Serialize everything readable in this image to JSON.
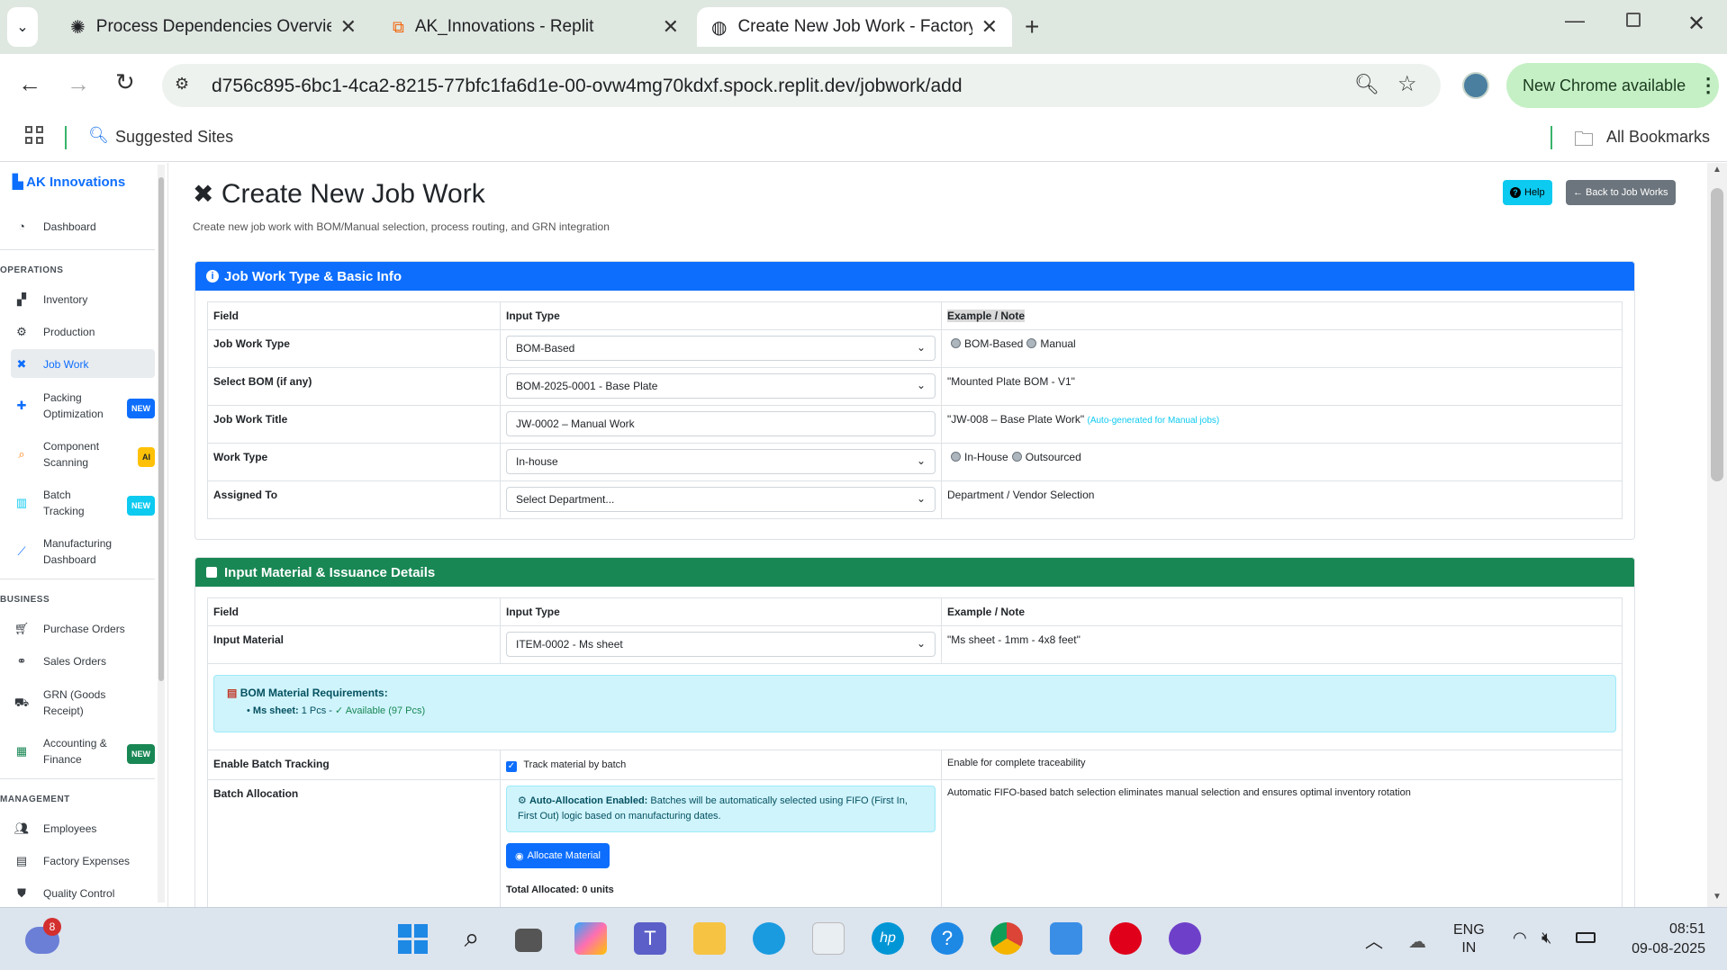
{
  "browser": {
    "tabs": [
      {
        "title": "Process Dependencies Overview"
      },
      {
        "title": "AK_Innovations - Replit"
      },
      {
        "title": "Create New Job Work - Factory"
      }
    ],
    "url": "d756c895-6bc1-4ca2-8215-77bfc1fa6d1e-00-ovw4mg70kdxf.spock.replit.dev/jobwork/add",
    "chrome_update": "New Chrome available",
    "bookmarks_left": "Suggested Sites",
    "bookmarks_right": "All Bookmarks"
  },
  "sidebar": {
    "brand": "AK Innovations",
    "dashboard": "Dashboard",
    "sec_operations": "OPERATIONS",
    "inventory": "Inventory",
    "production": "Production",
    "jobwork": "Job Work",
    "packing_1": "Packing",
    "packing_2": "Optimization",
    "component_1": "Component",
    "component_2": "Scanning",
    "batch_1": "Batch",
    "batch_2": "Tracking",
    "mfg_1": "Manufacturing",
    "mfg_2": "Dashboard",
    "sec_business": "BUSINESS",
    "po": "Purchase Orders",
    "so": "Sales Orders",
    "grn_1": "GRN (Goods",
    "grn_2": "Receipt)",
    "acct_1": "Accounting &",
    "acct_2": "Finance",
    "sec_management": "MANAGEMENT",
    "employees": "Employees",
    "expenses": "Factory Expenses",
    "quality": "Quality Control",
    "badge_new": "NEW",
    "badge_ai": "AI"
  },
  "page": {
    "title": "Create New Job Work",
    "subtitle": "Create new job work with BOM/Manual selection, process routing, and GRN integration",
    "help_btn": "Help",
    "back_btn": "← Back to Job Works"
  },
  "card1": {
    "header": "Job Work Type & Basic Info",
    "col_field": "Field",
    "col_input": "Input Type",
    "col_note": "Example / Note",
    "r1_field": "Job Work Type",
    "r1_value": "BOM-Based",
    "r1_opt1": "BOM-Based",
    "r1_opt2": "Manual",
    "r2_field": "Select BOM (if any)",
    "r2_value": "BOM-2025-0001 - Base Plate",
    "r2_note": "\"Mounted Plate BOM - V1\"",
    "r3_field": "Job Work Title",
    "r3_value": "JW-0002 – Manual Work",
    "r3_note": "\"JW-008 – Base Plate Work\"",
    "r3_note_hint": "(Auto-generated for Manual jobs)",
    "r4_field": "Work Type",
    "r4_value": "In-house",
    "r4_opt1": "In-House",
    "r4_opt2": "Outsourced",
    "r5_field": "Assigned To",
    "r5_value": "Select Department...",
    "r5_note": "Department / Vendor Selection"
  },
  "card2": {
    "header": "Input Material & Issuance Details",
    "col_field": "Field",
    "col_input": "Input Type",
    "col_note": "Example / Note",
    "r1_field": "Input Material",
    "r1_value": "ITEM-0002 - Ms sheet",
    "r1_note": "\"Ms sheet - 1mm - 4x8 feet\"",
    "bom_title": "BOM Material Requirements:",
    "bom_item": "Ms sheet:",
    "bom_qty": "1 Pcs -",
    "bom_avail": "✓ Available (97 Pcs)",
    "r2_field": "Enable Batch Tracking",
    "r2_check": "Track material by batch",
    "r2_note": "Enable for complete traceability",
    "r3_field": "Batch Allocation",
    "auto_title": "Auto-Allocation Enabled:",
    "auto_text": "Batches will be automatically selected using FIFO (First In, First Out) logic based on manufacturing dates.",
    "allocate_btn": "Allocate Material",
    "total": "Total Allocated: 0 units",
    "r3_note": "Automatic FIFO-based batch selection eliminates manual selection and ensures optimal inventory rotation"
  },
  "taskbar": {
    "notif_count": "8",
    "lang_1": "ENG",
    "lang_2": "IN",
    "time": "08:51",
    "date": "09-08-2025"
  },
  "colors": {
    "primary": "#0d6efd",
    "success": "#198754",
    "info": "#0dcaf0",
    "info_bg": "#cff4fc",
    "secondary": "#6c757d"
  }
}
